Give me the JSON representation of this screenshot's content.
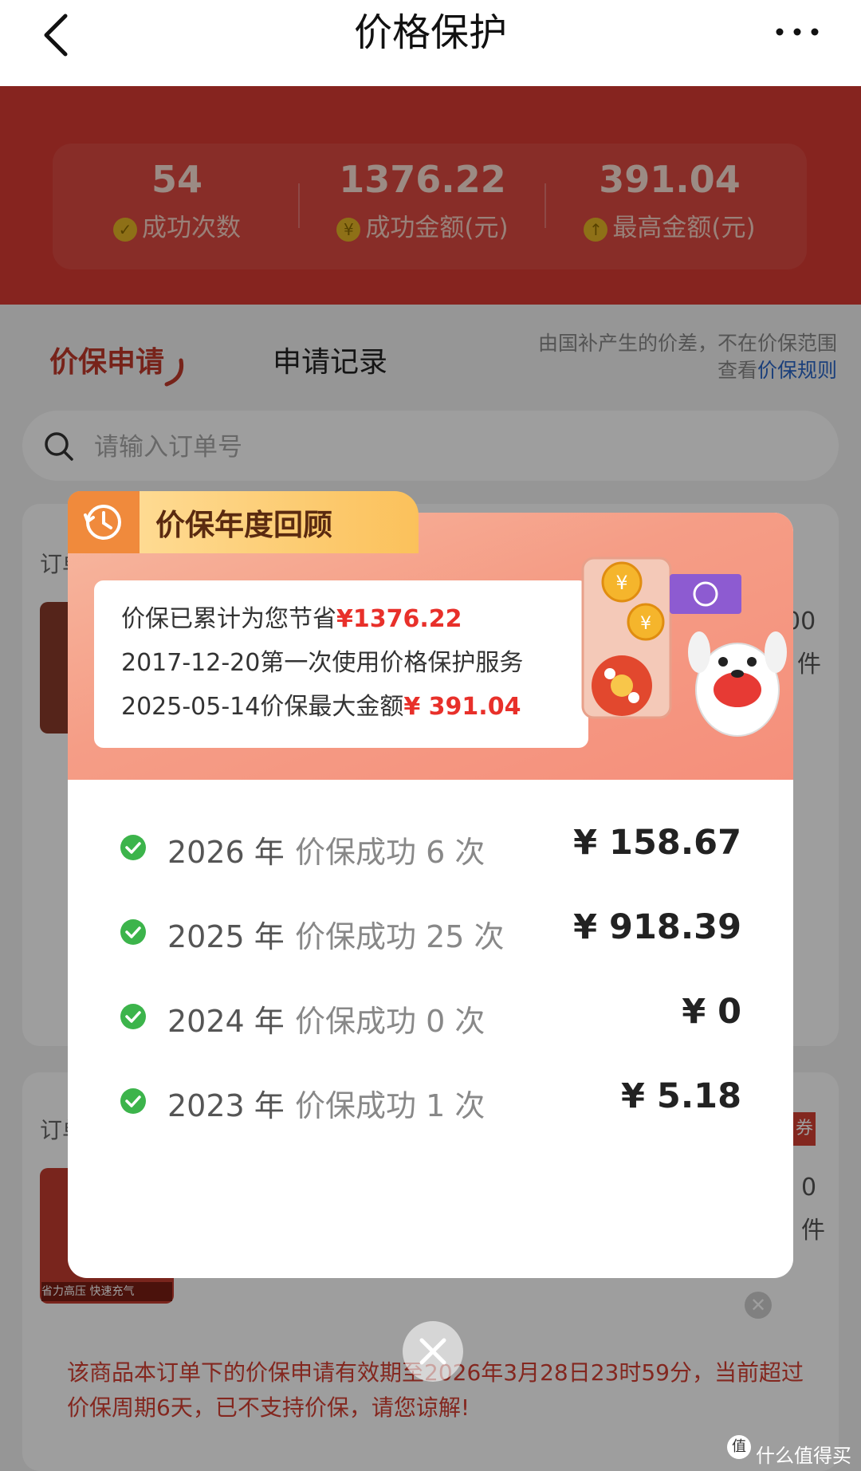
{
  "topbar": {
    "title": "价格保护"
  },
  "stats": [
    {
      "value": "54",
      "label": "成功次数",
      "icon": "check-circle-icon"
    },
    {
      "value": "1376.22",
      "label": "成功金额(元)",
      "icon": "yen-circle-icon"
    },
    {
      "value": "391.04",
      "label": "最高金额(元)",
      "icon": "arrow-up-circle-icon"
    }
  ],
  "tabs": {
    "active": "价保申请",
    "records": "申请记录"
  },
  "notice": {
    "line1": "由国补产生的价差，不在价保范围",
    "line2_prefix": "查看",
    "link": "价保规则"
  },
  "search": {
    "placeholder": "请输入订单号"
  },
  "background": {
    "order_label_1": "订单",
    "order_label_2": "订单",
    "peek_value": "00",
    "peek_unit": "件",
    "peek_value_2": "0",
    "peek_unit_2": "件",
    "coupon": "券",
    "thumb_banner": "省力高压 快速充气",
    "warning": "该商品本订单下的价保申请有效期至2026年3月28日23时59分，当前超过价保周期6天，已不支持价保，请您谅解!"
  },
  "modal": {
    "title": "价保年度回顾",
    "summary": {
      "line1_prefix": "价保已累计为您节省",
      "line1_amount": "¥1376.22",
      "line2": "2017-12-20第一次使用价格保护服务",
      "line3_prefix": "2025-05-14价保最大金额",
      "line3_amount": "¥ 391.04"
    },
    "years": [
      {
        "year": "2026 年",
        "count": "价保成功 6 次",
        "amount": "¥ 158.67"
      },
      {
        "year": "2025 年",
        "count": "价保成功 25 次",
        "amount": "¥ 918.39"
      },
      {
        "year": "2024 年",
        "count": "价保成功 0 次",
        "amount": "¥ 0"
      },
      {
        "year": "2023 年",
        "count": "价保成功 1 次",
        "amount": "¥ 5.18"
      }
    ]
  },
  "watermark": "什么值得买",
  "colors": {
    "brand_red": "#d93a32",
    "accent_red": "#e8302a",
    "check_green": "#3cb44b",
    "link_blue": "#2b66c7"
  }
}
